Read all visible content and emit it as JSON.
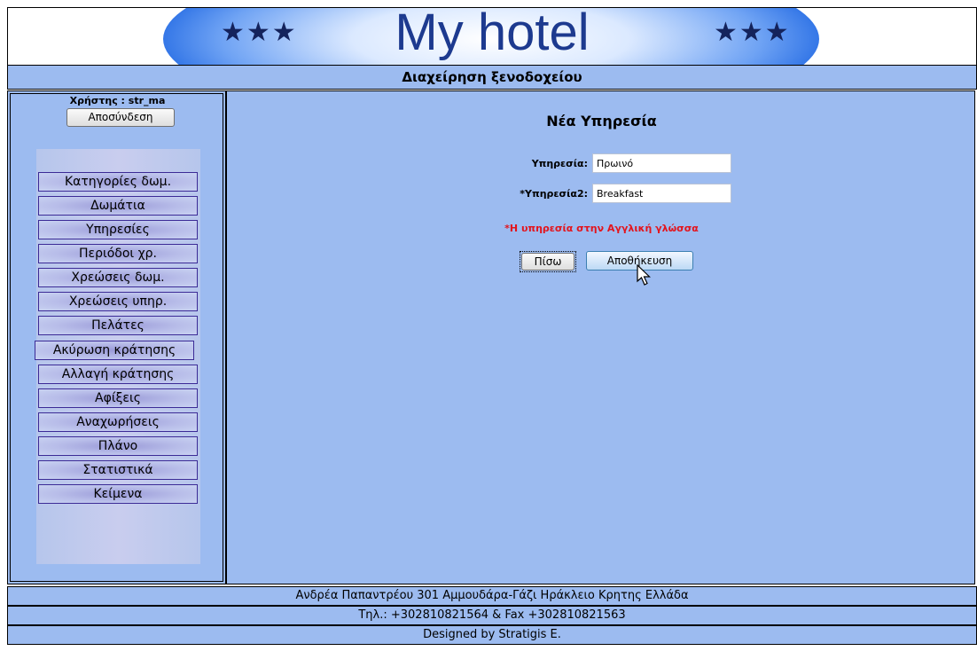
{
  "header": {
    "logo_text": "My hotel",
    "stars_left": "★★★",
    "stars_right": "★★★",
    "subtitle": "Διαχείρηση ξενοδοχείου"
  },
  "sidebar": {
    "user_label": "Χρήστης : str_ma",
    "logout_label": "Αποσύνδεση",
    "menu": [
      "Κατηγορίες δωμ.",
      "Δωμάτια",
      "Υπηρεσίες",
      "Περιόδοι χρ.",
      "Χρεώσεις δωμ.",
      "Χρεώσεις υπηρ.",
      "Πελάτες",
      "Ακύρωση κράτησης",
      "Αλλαγή κράτησης",
      "Αφίξεις",
      "Αναχωρήσεις",
      "Πλάνο",
      "Στατιστικά",
      "Κείμενα"
    ]
  },
  "form": {
    "title": "Νέα Υπηρεσία",
    "service_label": "Υπηρεσία:",
    "service_value": "Πρωινό",
    "service2_label": "*Υπηρεσία2:",
    "service2_value": "Breakfast",
    "note": "*Η υπηρεσία στην Αγγλική γλώσσα",
    "back_label": "Πίσω",
    "save_label": "Αποθήκευση"
  },
  "footer": {
    "address": "Ανδρέα Παπαντρέου 301 Αμμουδάρα-Γάζι Ηράκλειο Κρητης Ελλάδα",
    "phone": "Τηλ.: +302810821564 & Fax +302810821563",
    "designer": "Designed by Stratigis E."
  }
}
